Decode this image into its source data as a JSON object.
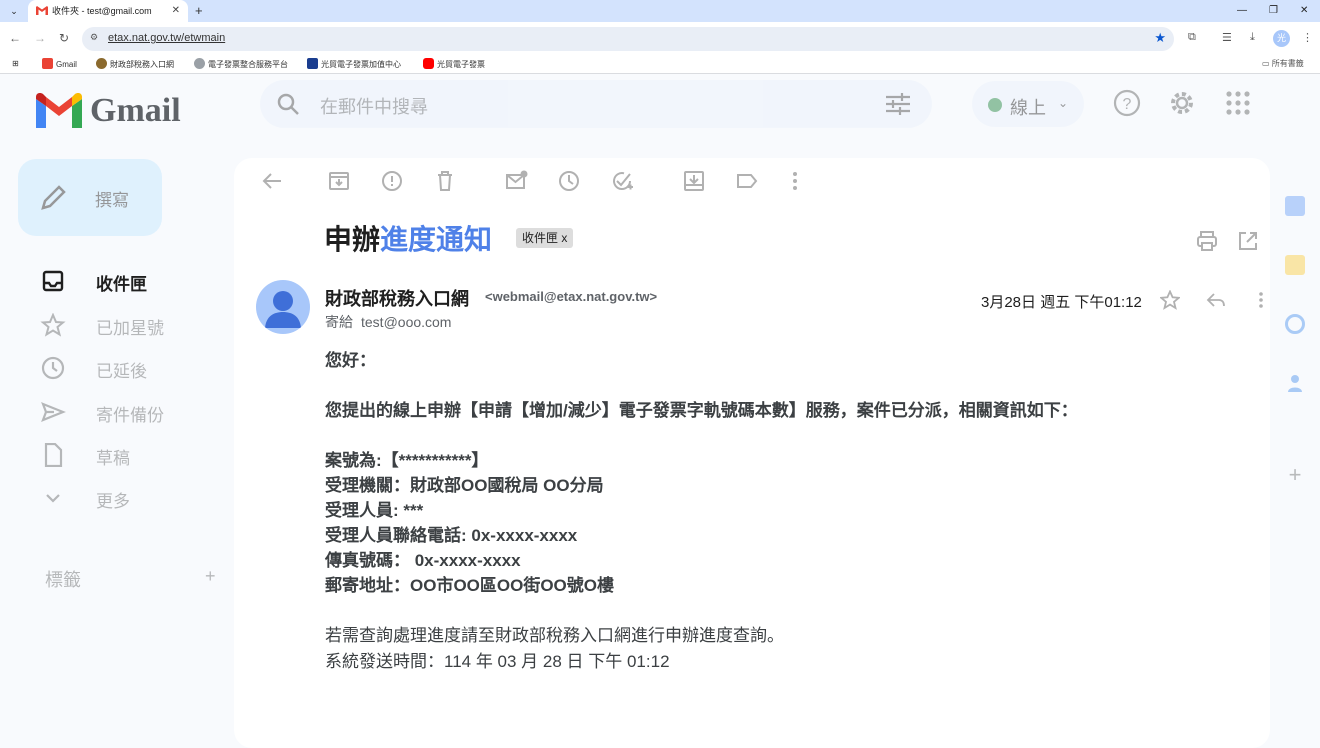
{
  "browser": {
    "tab_title": "收件夾 - test@gmail.com",
    "url": "etax.nat.gov.tw/etwmain",
    "profile_initial": "光",
    "bookmarks": [
      "Gmail",
      "財政部稅務入口網",
      "電子發票整合服務平台",
      "光貿電子發票加值中心",
      "光貿電子發票"
    ],
    "all_bookmarks": "所有書籤"
  },
  "gmail": {
    "logo_text": "Gmail",
    "search_placeholder": "在郵件中搜尋",
    "status": "線上",
    "compose_label": "撰寫",
    "nav": [
      {
        "label": "收件匣"
      },
      {
        "label": "已加星號"
      },
      {
        "label": "已延後"
      },
      {
        "label": "寄件備份"
      },
      {
        "label": "草稿"
      },
      {
        "label": "更多"
      }
    ],
    "labels_heading": "標籤",
    "labels_add": "+"
  },
  "message": {
    "subject_a": "申辦",
    "subject_b": "進度通知",
    "label_chip": "收件匣 x",
    "from_name": "財政部稅務入口網",
    "from_email": "<webmail@etax.nat.gov.tw>",
    "to_prefix": "寄給",
    "to_addr": "test@ooo.com",
    "date": "3月28日 週五 下午01:12",
    "greeting": "您好：",
    "intro": "您提出的線上申辦【申請【增加/減少】電子發票字軌號碼本數】服務，案件已分派，相關資訊如下：",
    "case_no": "案號為:【***********】",
    "agency": "受理機關：財政部OO國稅局 OO分局",
    "staff": "受理人員: ***",
    "phone": "受理人員聯絡電話: 0x-xxxx-xxxx",
    "fax": "傳真號碼： 0x-xxxx-xxxx",
    "address": "郵寄地址：OO市OO區OO街OO號O樓",
    "note": "若需查詢處理進度請至財政部稅務入口網進行申辦進度查詢。",
    "sent_time": "系統發送時間：114 年 03 月 28 日 下午 01:12"
  }
}
